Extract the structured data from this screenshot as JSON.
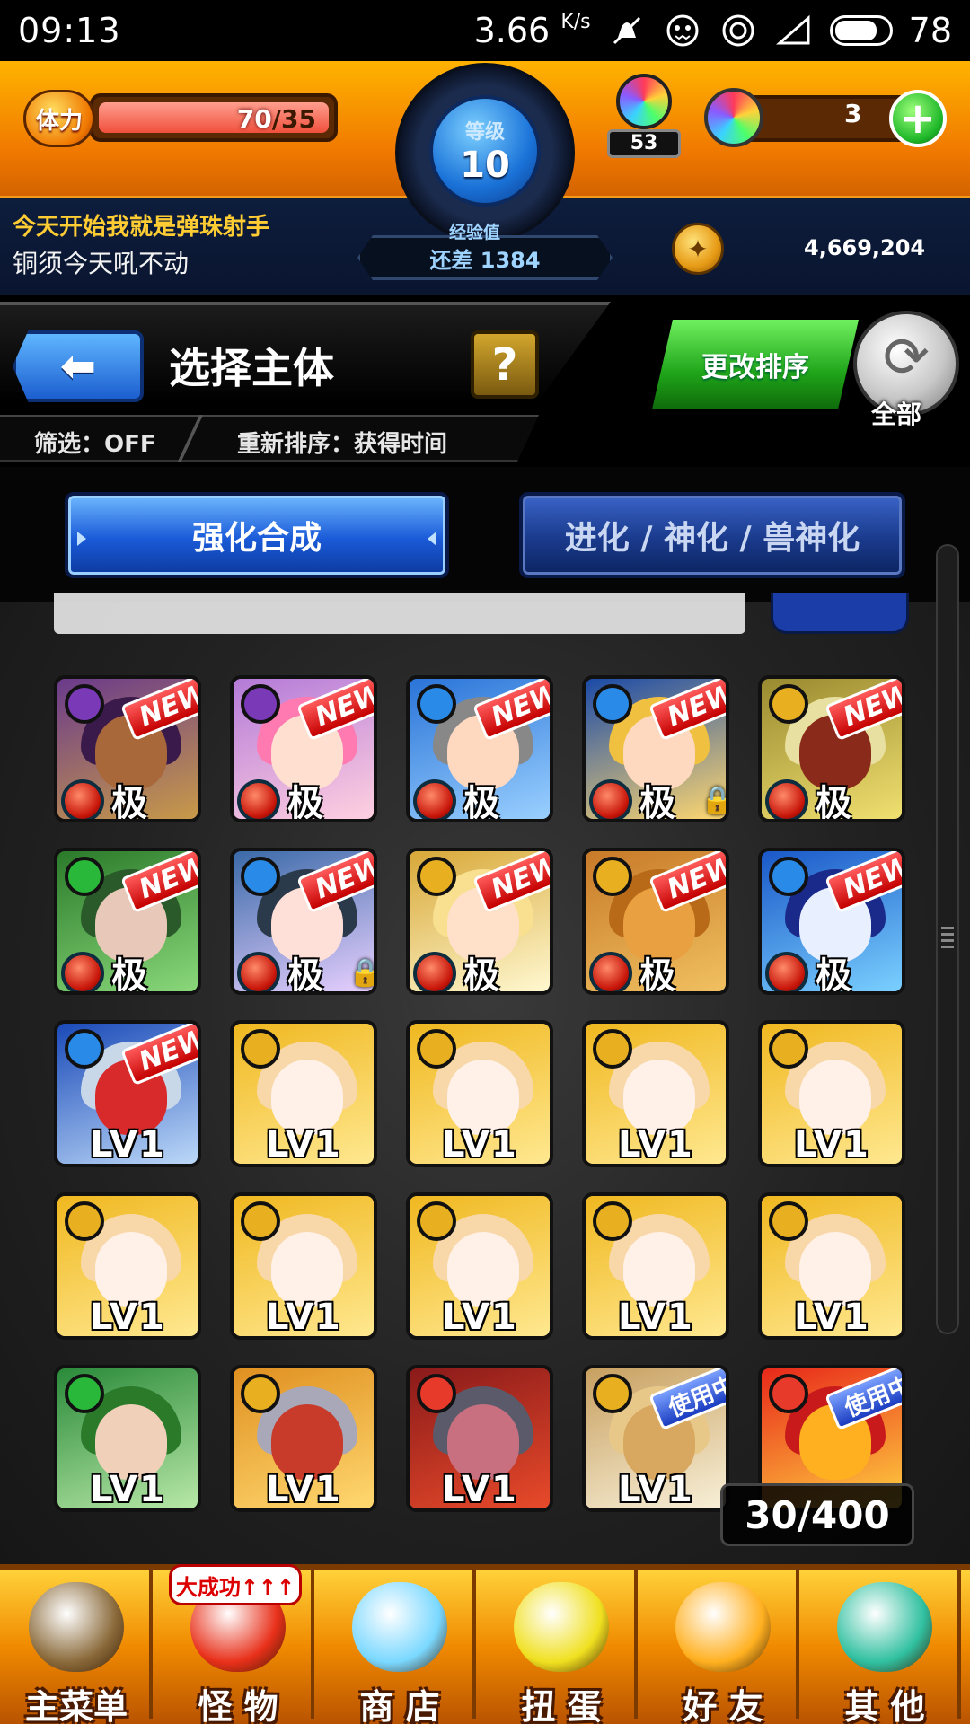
{
  "status_bar": {
    "time": "09:13",
    "network_speed": "3.66",
    "network_unit": "K/s",
    "battery": "78"
  },
  "hud": {
    "stamina_label": "体力",
    "stamina_current": "70",
    "stamina_max": "/35",
    "stamina_fill": 1.0,
    "level_label": "等级",
    "level_value": "10",
    "exp_label": "经验值",
    "exp_remaining": "还差 1384",
    "orb_count": "53",
    "gems": "3",
    "coins": "4,669,204",
    "player_title": "今天开始我就是弹珠射手",
    "player_name": "铜须今天吼不动"
  },
  "toolbar": {
    "back_arrow": "⬅",
    "title": "选择主体",
    "help": "?",
    "filter": "筛选：OFF",
    "sort": "重新排序：获得时间",
    "change_sort": "更改排序",
    "refresh_glyph": "⟳",
    "all_label": "全部"
  },
  "tabs": {
    "fusion": "强化合成",
    "evolve": "进化 / 神化 / 兽神化"
  },
  "badges": {
    "new": "NEW",
    "in_use": "使用中"
  },
  "grid": {
    "rows": [
      [
        {
          "rank": "极",
          "badge": "NEW",
          "attr": "dark",
          "bg": [
            "#6a3a8c",
            "#c89a48"
          ],
          "hair": "#3a1a4a",
          "face": "#a8683a"
        },
        {
          "rank": "极",
          "badge": "NEW",
          "attr": "dark",
          "bg": [
            "#b47ad8",
            "#ffd0e0"
          ],
          "hair": "#ff7ab0",
          "face": "#ffe0d0"
        },
        {
          "rank": "极",
          "badge": "NEW",
          "attr": "water",
          "bg": [
            "#2a74d8",
            "#9ad0ff"
          ],
          "hair": "#888888",
          "face": "#ffd8c0"
        },
        {
          "rank": "极",
          "badge": "NEW",
          "attr": "water",
          "bg": [
            "#1a4aa8",
            "#ffd870"
          ],
          "hair": "#f0c040",
          "face": "#ffd8c0",
          "locked": true
        },
        {
          "rank": "极",
          "badge": "NEW",
          "attr": "light",
          "bg": [
            "#9a8a30",
            "#f0e070"
          ],
          "hair": "#e8e0a0",
          "face": "#8a2a1a"
        }
      ],
      [
        {
          "rank": "极",
          "badge": "NEW",
          "attr": "wood",
          "bg": [
            "#2a7a2a",
            "#8ad87a"
          ],
          "hair": "#2a5a2a",
          "face": "#e8c8b8"
        },
        {
          "rank": "极",
          "badge": "NEW",
          "attr": "water",
          "bg": [
            "#3a6aa8",
            "#e8d0ff"
          ],
          "hair": "#2a3a4a",
          "face": "#ffe0d8",
          "locked": true
        },
        {
          "rank": "极",
          "badge": "NEW",
          "attr": "light",
          "bg": [
            "#d8a838",
            "#fff8d0"
          ],
          "hair": "#f8e090",
          "face": "#ffe0c8"
        },
        {
          "rank": "极",
          "badge": "NEW",
          "attr": "light",
          "bg": [
            "#c87a28",
            "#f0c060"
          ],
          "hair": "#b86a18",
          "face": "#e8a040"
        },
        {
          "rank": "极",
          "badge": "NEW",
          "attr": "water",
          "bg": [
            "#1a58c8",
            "#7ad0ff"
          ],
          "hair": "#1a2a8a",
          "face": "#e8f0ff"
        }
      ],
      [
        {
          "rank": "LV1",
          "badge": "NEW",
          "attr": "water",
          "bg": [
            "#1a4ab8",
            "#bcd8f8"
          ],
          "hair": "#c8d8e8",
          "face": "#d82a2a"
        },
        {
          "rank": "LV1",
          "attr": "light",
          "bg": [
            "#f0b820",
            "#ffe890"
          ],
          "hair": "#f8d8a8",
          "face": "#fff0e8"
        },
        {
          "rank": "LV1",
          "attr": "light",
          "bg": [
            "#f0b820",
            "#ffe890"
          ],
          "hair": "#f8d8a8",
          "face": "#fff0e8"
        },
        {
          "rank": "LV1",
          "attr": "light",
          "bg": [
            "#f0b820",
            "#ffe890"
          ],
          "hair": "#f8d8a8",
          "face": "#fff0e8"
        },
        {
          "rank": "LV1",
          "attr": "light",
          "bg": [
            "#f0b820",
            "#ffe890"
          ],
          "hair": "#f8d8a8",
          "face": "#fff0e8"
        }
      ],
      [
        {
          "rank": "LV1",
          "attr": "light",
          "bg": [
            "#f0b820",
            "#ffe890"
          ],
          "hair": "#f8d8a8",
          "face": "#fff0e8"
        },
        {
          "rank": "LV1",
          "attr": "light",
          "bg": [
            "#f0b820",
            "#ffe890"
          ],
          "hair": "#f8d8a8",
          "face": "#fff0e8"
        },
        {
          "rank": "LV1",
          "attr": "light",
          "bg": [
            "#f0b820",
            "#ffe890"
          ],
          "hair": "#f8d8a8",
          "face": "#fff0e8"
        },
        {
          "rank": "LV1",
          "attr": "light",
          "bg": [
            "#f0b820",
            "#ffe890"
          ],
          "hair": "#f8d8a8",
          "face": "#fff0e8"
        },
        {
          "rank": "LV1",
          "attr": "light",
          "bg": [
            "#f0b820",
            "#ffe890"
          ],
          "hair": "#f8d8a8",
          "face": "#fff0e8"
        }
      ],
      [
        {
          "rank": "LV1",
          "attr": "wood",
          "bg": [
            "#2a8a3a",
            "#b8e8a8"
          ],
          "hair": "#2a7a2a",
          "face": "#f0d0b8"
        },
        {
          "rank": "LV1",
          "attr": "light",
          "bg": [
            "#e09020",
            "#ffd870"
          ],
          "hair": "#a8a8b8",
          "face": "#c83a2a"
        },
        {
          "rank": "LV1",
          "attr": "fire",
          "bg": [
            "#8a1a1a",
            "#e84a2a"
          ],
          "hair": "#5a5a6a",
          "face": "#c87080"
        },
        {
          "rank": "LV1",
          "badge": "使用中",
          "attr": "light",
          "bg": [
            "#c8a060",
            "#f8f0d8"
          ],
          "hair": "#e8c888",
          "face": "#d8a860"
        },
        {
          "badge": "使用中",
          "attr": "fire",
          "bg": [
            "#e8281a",
            "#ffd040"
          ],
          "hair": "#c81a1a",
          "face": "#ffb020"
        }
      ]
    ],
    "box_count": "30/400"
  },
  "bottom_nav": {
    "promo": "大成功↑↑↑",
    "items": [
      {
        "label": "主菜单",
        "icon": "gate-icon",
        "color": "#8a6a3a"
      },
      {
        "label": "怪 物",
        "icon": "monster-icon",
        "color": "#e8301a"
      },
      {
        "label": "商 店",
        "icon": "orb-icon",
        "color": "#7ad8ff"
      },
      {
        "label": "扭 蛋",
        "icon": "egg-icon",
        "color": "#f0e020"
      },
      {
        "label": "好 友",
        "icon": "friends-icon",
        "color": "#ffb020"
      },
      {
        "label": "其 他",
        "icon": "question-icon",
        "color": "#30c0a0"
      }
    ]
  },
  "attr_colors": {
    "dark": "#7a3ab8",
    "water": "#2a8ae8",
    "light": "#e8b020",
    "wood": "#2ab83a",
    "fire": "#e83a2a"
  }
}
